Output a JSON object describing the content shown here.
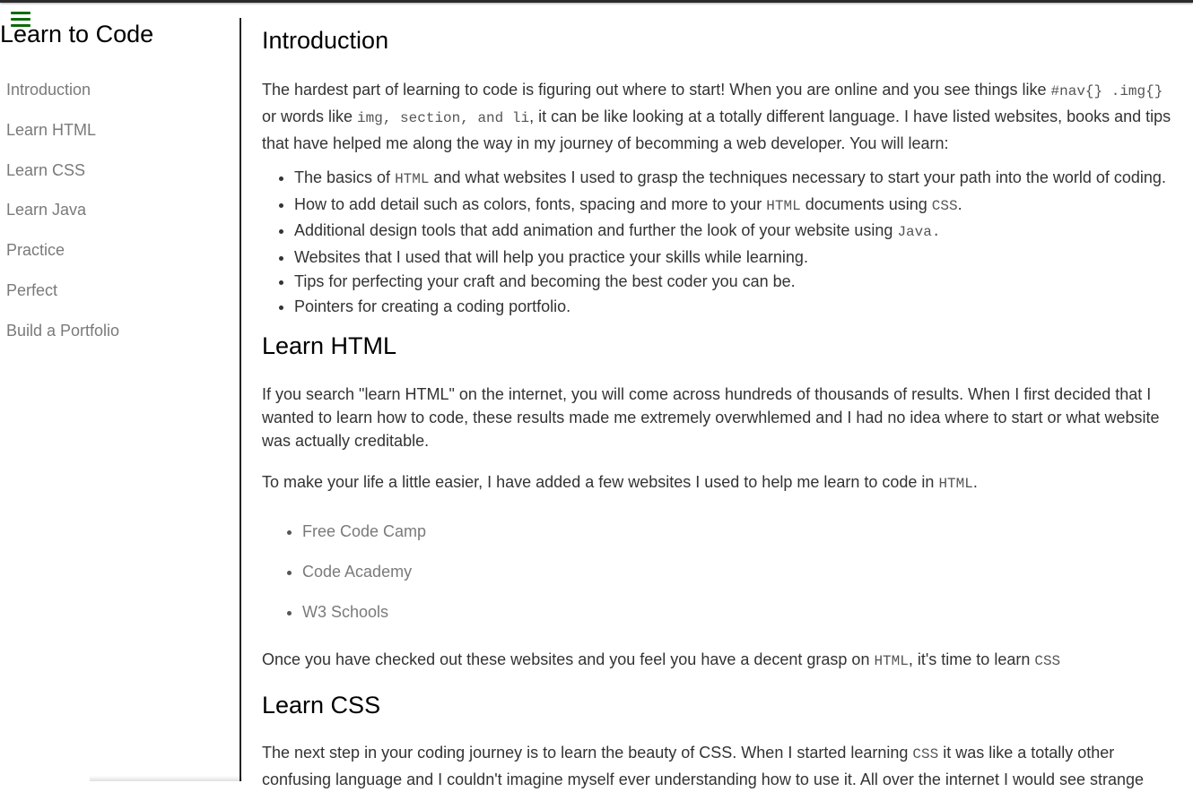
{
  "sidebar": {
    "title": "Learn to Code",
    "menu_icon": "hamburger-menu-icon",
    "menu_color": "#0b6b0b",
    "items": [
      "Introduction",
      "Learn HTML",
      "Learn CSS",
      "Learn Java",
      "Practice",
      "Perfect",
      "Build a Portfolio"
    ]
  },
  "intro": {
    "title": "Introduction",
    "p1": {
      "a": "The hardest part of learning to code is figuring out where to start! When you are online and you see things like ",
      "code1": "#nav{} .img{}",
      "b": " or words like ",
      "code2": "img, section, and li",
      "c": ", it can be like looking at a totally different language. I have listed websites, books and tips that have helped me along the way in my journey of becomming a web developer. You will learn:"
    },
    "bullets": [
      {
        "pre": "The basics of ",
        "code": "HTML",
        "post": " and what websites I used to grasp the techniques necessary to start your path into the world of coding."
      },
      {
        "pre": "How to add detail such as colors, fonts, spacing and more to your ",
        "code": "HTML",
        "mid": " documents using ",
        "code2": "CSS",
        "post": "."
      },
      {
        "pre": "Additional design tools that add animation and further the look of your website using ",
        "code": "Java.",
        "post": ""
      },
      {
        "text": "Websites that I used that will help you practice your skills while learning."
      },
      {
        "text": "Tips for perfecting your craft and becoming the best coder you can be."
      },
      {
        "text": "Pointers for creating a coding portfolio."
      }
    ]
  },
  "html_section": {
    "title": "Learn HTML",
    "p1": "If you search \"learn HTML\" on the internet, you will come across hundreds of thousands of results. When I first decided that I wanted to learn how to code, these results made me extremely overwhlemed and I had no idea where to start or what website was actually creditable.",
    "p2_pre": "To make your life a little easier, I have added a few websites I used to help me learn to code in ",
    "p2_code": "HTML",
    "p2_post": ".",
    "links": [
      "Free Code Camp",
      "Code Academy",
      "W3 Schools"
    ],
    "p3_pre": "Once you have checked out these websites and you feel you have a decent grasp on ",
    "p3_code": "HTML",
    "p3_mid": ", it's time to learn ",
    "p3_code2": "CSS"
  },
  "css_section": {
    "title": "Learn CSS",
    "p1_pre": "The next step in your coding journey is to learn the beauty of CSS. When I started learning ",
    "p1_code": "CSS",
    "p1_post": " it was like a totally other confusing language and I couldn't imagine myself ever understanding how to use it. All over the internet I would see strange"
  }
}
